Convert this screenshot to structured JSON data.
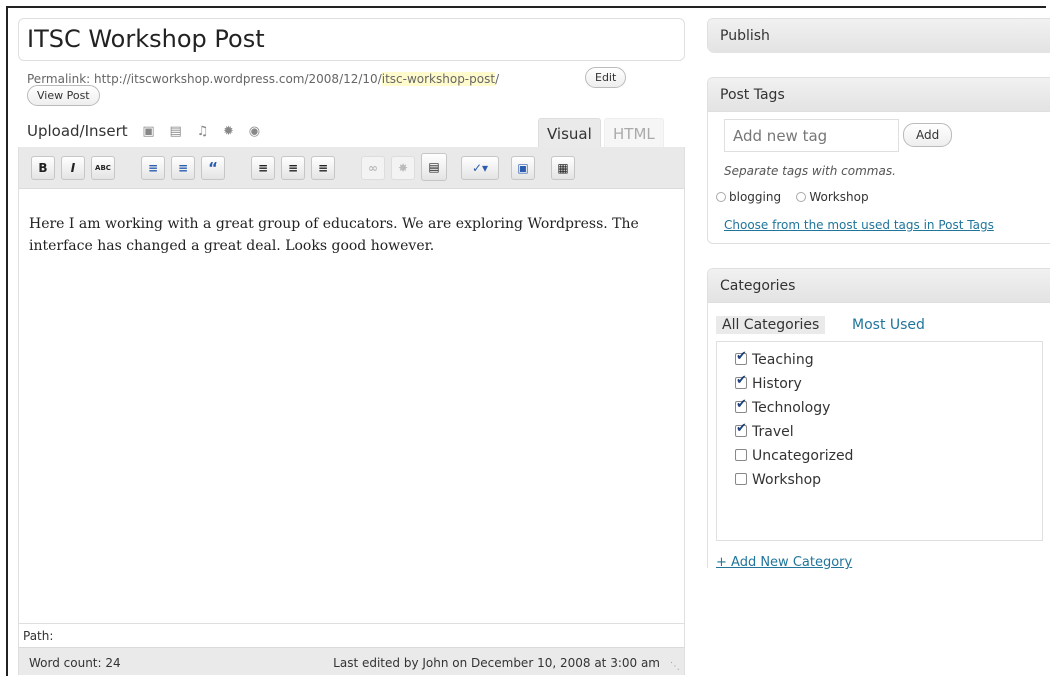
{
  "post": {
    "title": "ITSC Workshop Post",
    "permalink_label": "Permalink:",
    "permalink_base": " http://itscworkshop.wordpress.com/2008/12/10/",
    "permalink_slug": "itsc-workshop-post",
    "permalink_tail": "/",
    "edit_label": "Edit",
    "view_post_label": "View Post"
  },
  "media": {
    "upload_label": "Upload/Insert",
    "icons": [
      "image-icon",
      "video-icon",
      "audio-icon",
      "media-icon",
      "gallery-icon"
    ]
  },
  "editor_tabs": {
    "visual": "Visual",
    "html": "HTML"
  },
  "toolbar": {
    "bold": "B",
    "italic": "I",
    "strike": "ABC",
    "quote": "“"
  },
  "content": {
    "body": "Here I am working with a great group of educators. We are exploring Wordpress. The interface has changed a great deal. Looks good however."
  },
  "footer": {
    "path_label": "Path:",
    "word_count": "Word count: 24",
    "last_edited": "Last edited by John on December 10, 2008 at 3:00 am"
  },
  "publish": {
    "title": "Publish"
  },
  "tags": {
    "title": "Post Tags",
    "input_placeholder": "Add new tag",
    "add_label": "Add",
    "hint": "Separate tags with commas.",
    "items": [
      "blogging",
      "Workshop"
    ],
    "choose_link": "Choose from the most used tags in Post Tags"
  },
  "categories": {
    "title": "Categories",
    "tab_all": "All Categories",
    "tab_used": "Most Used",
    "items": [
      {
        "label": "Teaching",
        "checked": true
      },
      {
        "label": "History",
        "checked": true
      },
      {
        "label": "Technology",
        "checked": true
      },
      {
        "label": "Travel",
        "checked": true
      },
      {
        "label": "Uncategorized",
        "checked": false
      },
      {
        "label": "Workshop",
        "checked": false
      }
    ],
    "add_link": "+ Add New Category"
  },
  "colors": {
    "link": "#21759b",
    "slug_highlight": "#fffbcc",
    "toolbar_bg": "#e9e9e9"
  }
}
